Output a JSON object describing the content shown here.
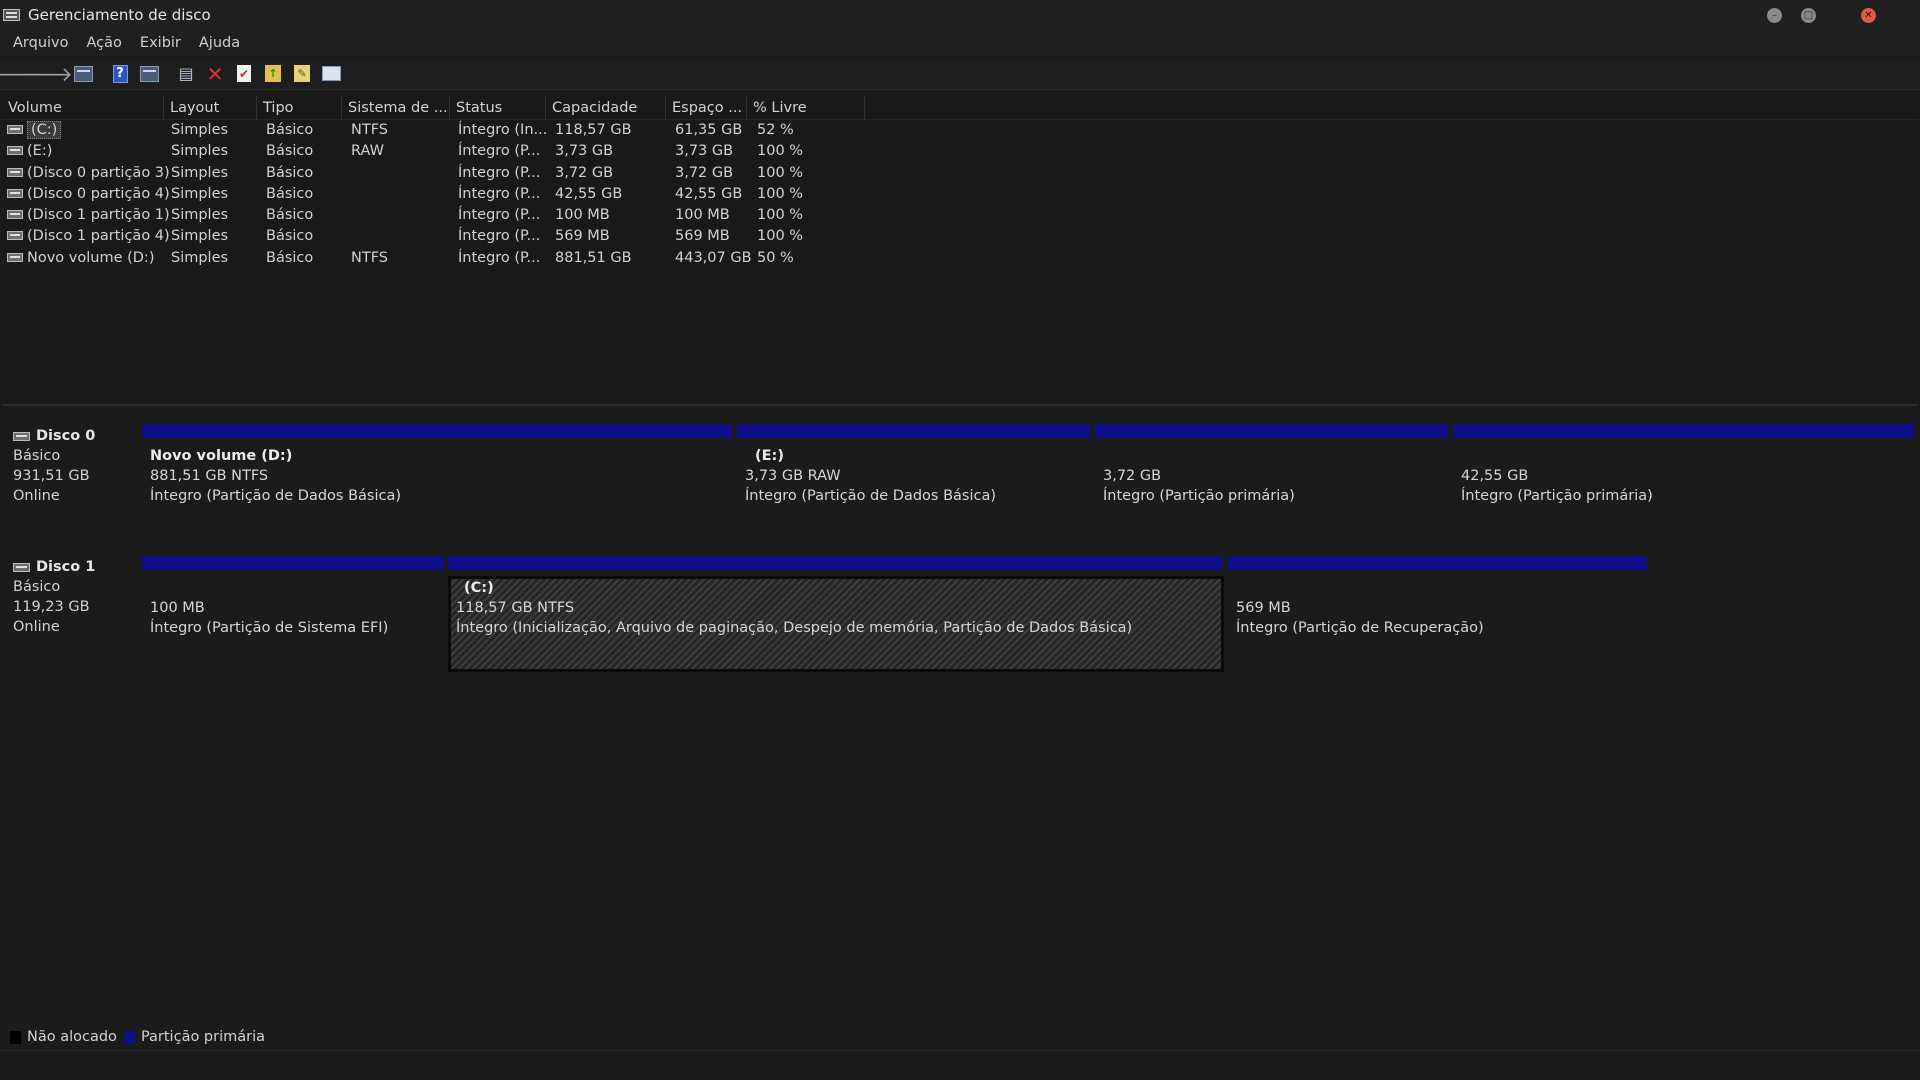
{
  "window": {
    "title": "Gerenciamento de disco"
  },
  "menu": {
    "items": [
      "Arquivo",
      "Ação",
      "Exibir",
      "Ajuda"
    ]
  },
  "volume_list": {
    "columns": [
      "Volume",
      "Layout",
      "Tipo",
      "Sistema de ...",
      "Status",
      "Capacidade",
      "Espaço ...",
      "% Livre"
    ],
    "rows": [
      {
        "volume": "(C:)",
        "layout": "Simples",
        "tipo": "Básico",
        "fs": "NTFS",
        "status": "Íntegro (In...",
        "capacidade": "118,57 GB",
        "espaco": "61,35 GB",
        "livre": "52 %"
      },
      {
        "volume": "(E:)",
        "layout": "Simples",
        "tipo": "Básico",
        "fs": "RAW",
        "status": "Íntegro (P...",
        "capacidade": "3,73 GB",
        "espaco": "3,73 GB",
        "livre": "100 %"
      },
      {
        "volume": "(Disco 0 partição 3)",
        "layout": "Simples",
        "tipo": "Básico",
        "fs": "",
        "status": "Íntegro (P...",
        "capacidade": "3,72 GB",
        "espaco": "3,72 GB",
        "livre": "100 %"
      },
      {
        "volume": "(Disco 0 partição 4)",
        "layout": "Simples",
        "tipo": "Básico",
        "fs": "",
        "status": "Íntegro (P...",
        "capacidade": "42,55 GB",
        "espaco": "42,55 GB",
        "livre": "100 %"
      },
      {
        "volume": "(Disco 1 partição 1)",
        "layout": "Simples",
        "tipo": "Básico",
        "fs": "",
        "status": "Íntegro (P...",
        "capacidade": "100 MB",
        "espaco": "100 MB",
        "livre": "100 %"
      },
      {
        "volume": "(Disco 1 partição 4)",
        "layout": "Simples",
        "tipo": "Básico",
        "fs": "",
        "status": "Íntegro (P...",
        "capacidade": "569 MB",
        "espaco": "569 MB",
        "livre": "100 %"
      },
      {
        "volume": "Novo volume (D:)",
        "layout": "Simples",
        "tipo": "Básico",
        "fs": "NTFS",
        "status": "Íntegro (P...",
        "capacidade": "881,51 GB",
        "espaco": "443,07 GB",
        "livre": "50 %"
      }
    ]
  },
  "disks": [
    {
      "name": "Disco 0",
      "type": "Básico",
      "size": "931,51 GB",
      "state": "Online",
      "partitions": [
        {
          "title": "Novo volume  (D:)",
          "size": "881,51 GB NTFS",
          "status": "Íntegro (Partição de Dados Básica)"
        },
        {
          "title": "(E:)",
          "size": "3,73 GB RAW",
          "status": "Íntegro (Partição de Dados Básica)"
        },
        {
          "title": "",
          "size": "3,72 GB",
          "status": "Íntegro (Partição primária)"
        },
        {
          "title": "",
          "size": "42,55 GB",
          "status": "Íntegro (Partição primária)"
        }
      ]
    },
    {
      "name": "Disco 1",
      "type": "Básico",
      "size": "119,23 GB",
      "state": "Online",
      "partitions": [
        {
          "title": "",
          "size": "100 MB",
          "status": "Íntegro (Partição de Sistema EFI)"
        },
        {
          "title": "(C:)",
          "size": "118,57 GB NTFS",
          "status": "Íntegro (Inicialização, Arquivo de paginação, Despejo de memória, Partição de Dados Básica)"
        },
        {
          "title": "",
          "size": "569 MB",
          "status": "Íntegro (Partição de Recuperação)"
        }
      ]
    }
  ],
  "legend": [
    {
      "label": "Não alocado",
      "color": "#000000"
    },
    {
      "label": "Partição primária",
      "color": "#0f0f8a"
    }
  ],
  "colors": {
    "primary_partition": "#0f0f8a",
    "unallocated": "#000000",
    "background": "#1b1b1b"
  }
}
